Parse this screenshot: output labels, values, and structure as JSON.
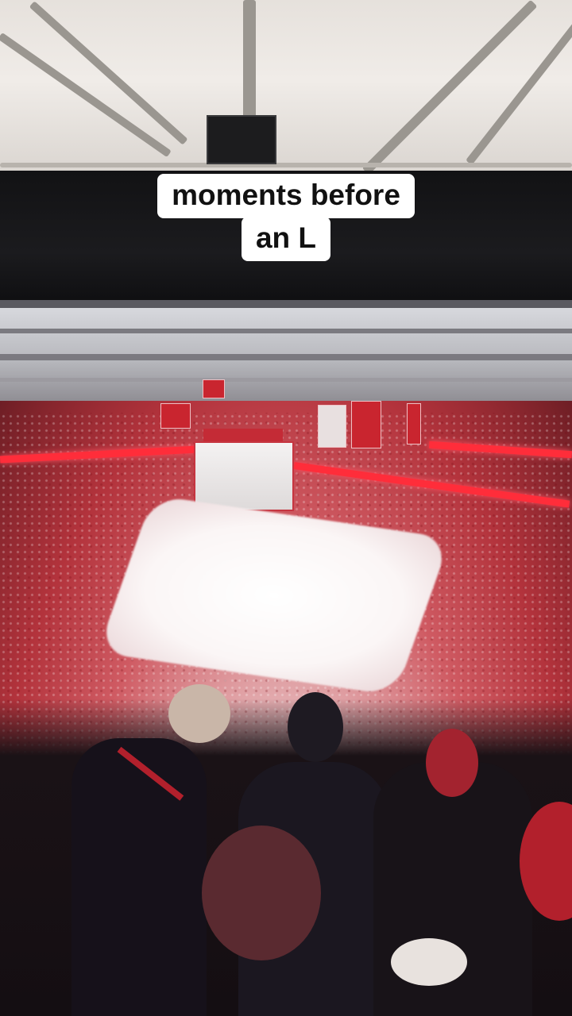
{
  "caption": {
    "line1": "moments before",
    "line2": "an L"
  },
  "scene": {
    "subject": "hockey-arena-crowd",
    "colors": {
      "crowd_red": "#cf3a44",
      "ice": "#ffffff",
      "fascia": "#141416",
      "roof": "#ece8e4"
    }
  }
}
